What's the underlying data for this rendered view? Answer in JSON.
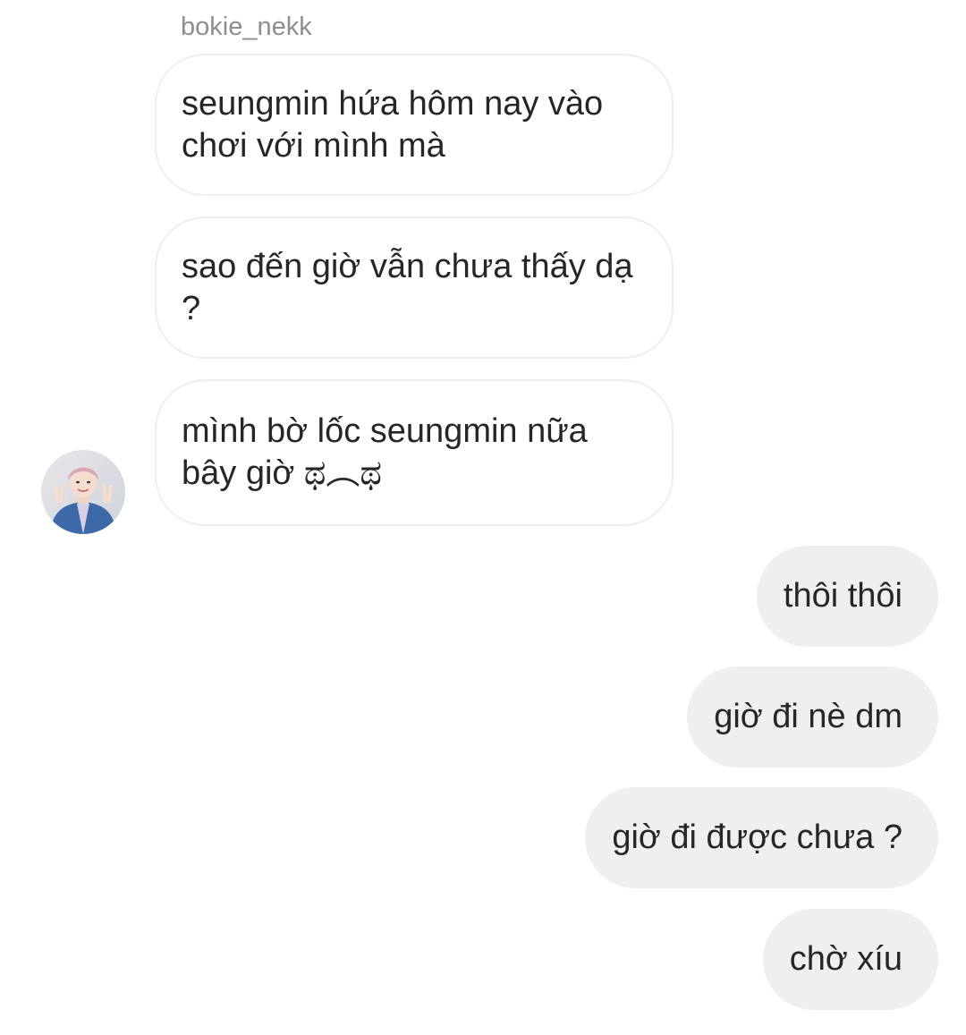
{
  "thread": {
    "sender_name": "bokie_nekk",
    "incoming": [
      {
        "text": "seungmin hứa hôm nay vào chơi với mình mà"
      },
      {
        "text": "sao đến giờ vẫn chưa thấy dạ ?"
      },
      {
        "text": "mình bờ lốc seungmin nữa bây giờ ಥ︵ಥ"
      }
    ],
    "outgoing": [
      {
        "text": "thôi thôi"
      },
      {
        "text": "giờ đi nè dm"
      },
      {
        "text": "giờ đi được chưa ?"
      },
      {
        "text": "chờ xíu"
      }
    ],
    "avatar_icon": "profile-photo-icon"
  },
  "colors": {
    "incoming_bubble_border": "#efefef",
    "outgoing_bubble_bg": "#efefef",
    "text": "#262626",
    "sender_name": "#8e8e8e"
  }
}
